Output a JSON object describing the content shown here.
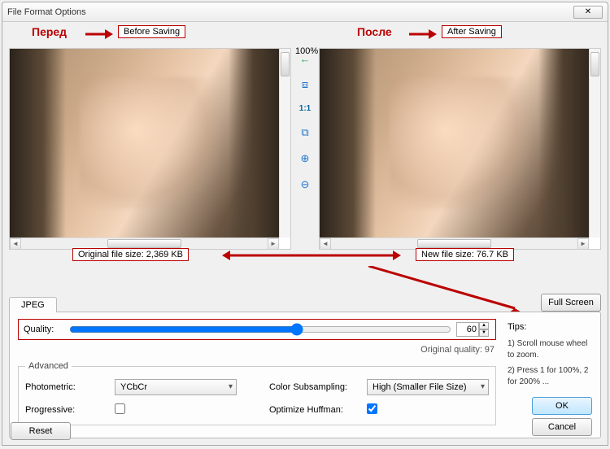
{
  "window": {
    "title": "File Format Options"
  },
  "annotations": {
    "before_ru": "Перед",
    "after_ru": "После"
  },
  "labels": {
    "before_saving": "Before Saving",
    "after_saving": "After Saving"
  },
  "zoom_percent": "100%",
  "file_sizes": {
    "original_label": "Original file size:",
    "original_value": "2,369 KB",
    "new_label": "New file size:",
    "new_value": "76.7 KB"
  },
  "tool_icons": {
    "pan_left": "←",
    "fit": "⧈",
    "ratio": "1:1",
    "both": "⧉",
    "zoom_in": "⊕",
    "zoom_out": "⊖"
  },
  "tab": {
    "jpeg": "JPEG"
  },
  "buttons": {
    "full_screen": "Full Screen",
    "reset": "Reset",
    "ok": "OK",
    "cancel": "Cancel"
  },
  "quality": {
    "label": "Quality:",
    "value": "60",
    "original_label": "Original quality:",
    "original_value": "97"
  },
  "advanced": {
    "legend": "Advanced",
    "photometric_label": "Photometric:",
    "photometric_value": "YCbCr",
    "subsampling_label": "Color Subsampling:",
    "subsampling_value": "High (Smaller File Size)",
    "progressive_label": "Progressive:",
    "progressive_checked": false,
    "huffman_label": "Optimize Huffman:",
    "huffman_checked": true
  },
  "tips": {
    "heading": "Tips:",
    "line1": "1) Scroll mouse wheel to zoom.",
    "line2": "2) Press 1 for 100%, 2 for 200% ..."
  }
}
